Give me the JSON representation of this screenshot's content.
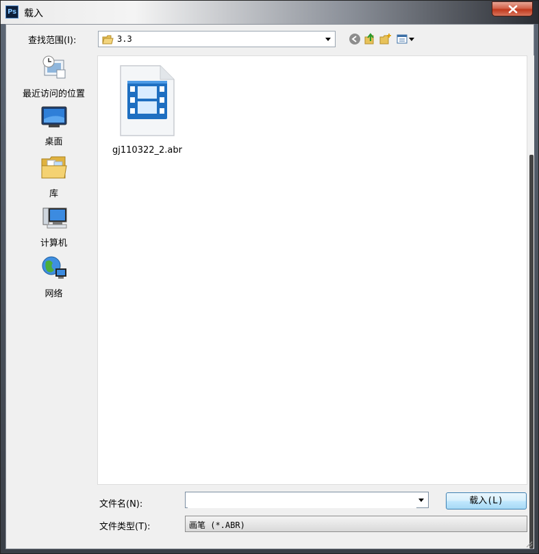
{
  "window": {
    "title": "载入",
    "app_icon": "Ps",
    "close_glyph": "✕"
  },
  "toolbar": {
    "lookin_label": "查找范围(I):",
    "lookin_value": "3.3",
    "icons": [
      "back-icon",
      "up-folder-icon",
      "new-folder-icon",
      "view-menu-icon"
    ]
  },
  "places": [
    {
      "label": "最近访问的位置",
      "icon": "recent-places-icon"
    },
    {
      "label": "桌面",
      "icon": "desktop-icon"
    },
    {
      "label": "库",
      "icon": "libraries-icon"
    },
    {
      "label": "计算机",
      "icon": "computer-icon"
    },
    {
      "label": "网络",
      "icon": "network-icon"
    }
  ],
  "files": [
    {
      "name": "gj110322_2.abr",
      "icon": "video-file-icon"
    }
  ],
  "footer": {
    "filename_label": "文件名(N):",
    "filename_value": "",
    "filetype_label": "文件类型(T):",
    "filetype_value": "画笔 (*.ABR)",
    "load_button": "载入(L)"
  },
  "colors": {
    "accent": "#3c7fb1",
    "close": "#c0391d",
    "file_icon_blue": "#1f6fc1"
  }
}
